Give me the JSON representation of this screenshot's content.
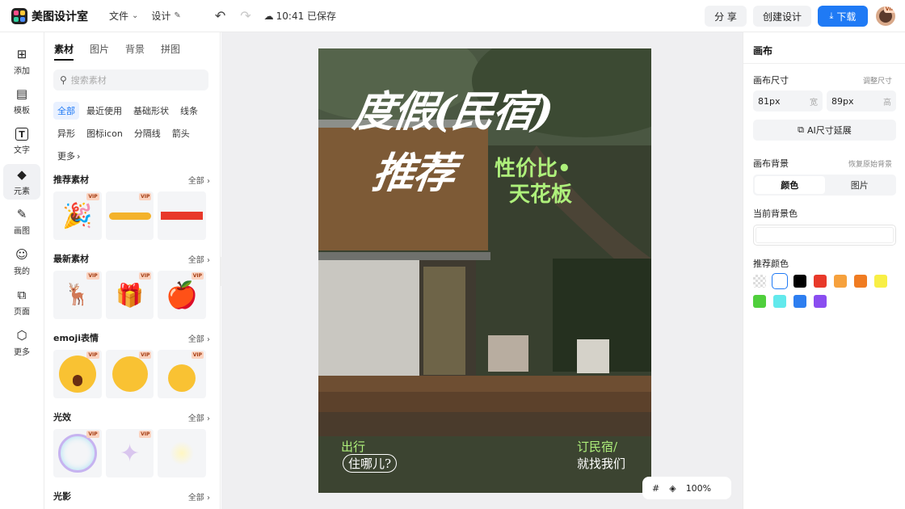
{
  "app": {
    "title": "美图设计室"
  },
  "menu": {
    "file": "文件",
    "design": "设计",
    "save_status": "10:41 已保存"
  },
  "header_buttons": {
    "share": "分 享",
    "create": "创建设计",
    "download": "下载",
    "avatar_badge": "VIP"
  },
  "leftnav": [
    {
      "label": "添加"
    },
    {
      "label": "模板"
    },
    {
      "label": "文字"
    },
    {
      "label": "元素"
    },
    {
      "label": "画图"
    },
    {
      "label": "我的"
    },
    {
      "label": "页面"
    },
    {
      "label": "更多"
    }
  ],
  "panel": {
    "tabs": [
      "素材",
      "图片",
      "背景",
      "拼图"
    ],
    "search_placeholder": "搜索素材",
    "chips": [
      "全部",
      "最近使用",
      "基础形状",
      "线条",
      "异形",
      "图标icon",
      "分隔线",
      "箭头",
      "更多"
    ],
    "sections": [
      {
        "title": "推荐素材",
        "all": "全部"
      },
      {
        "title": "最新素材",
        "all": "全部"
      },
      {
        "title": "emoji表情",
        "all": "全部"
      },
      {
        "title": "光效",
        "all": "全部"
      },
      {
        "title": "光影",
        "all": "全部"
      }
    ],
    "vip": "VIP"
  },
  "poster": {
    "title_line1": "度假(民宿)",
    "title_line2": "推荐",
    "sub_line1": "性价比•",
    "sub_line2": "天花板",
    "bottom_left_1": "出行",
    "bottom_left_2": "住哪儿?",
    "bottom_right_1": "订民宿/",
    "bottom_right_2": "就找我们"
  },
  "canvas_controls": {
    "zoom": "100%"
  },
  "right": {
    "title": "画布",
    "size_label": "画布尺寸",
    "size_link": "调整尺寸",
    "width_value": "81px",
    "width_unit": "宽",
    "height_value": "89px",
    "height_unit": "高",
    "ai_expand": "AI尺寸延展",
    "bg_label": "画布背景",
    "bg_reset": "恢复原始背景",
    "seg_color": "颜色",
    "seg_image": "图片",
    "current_bg": "当前背景色",
    "recommend": "推荐颜色",
    "swatches": [
      "transparent",
      "#ffffff",
      "#000000",
      "#e8392a",
      "#f6a13d",
      "#f07c22",
      "#f8ef45",
      "#4fcf3c",
      "#62e9ec",
      "#2d7ef0",
      "#8a4df0"
    ]
  }
}
